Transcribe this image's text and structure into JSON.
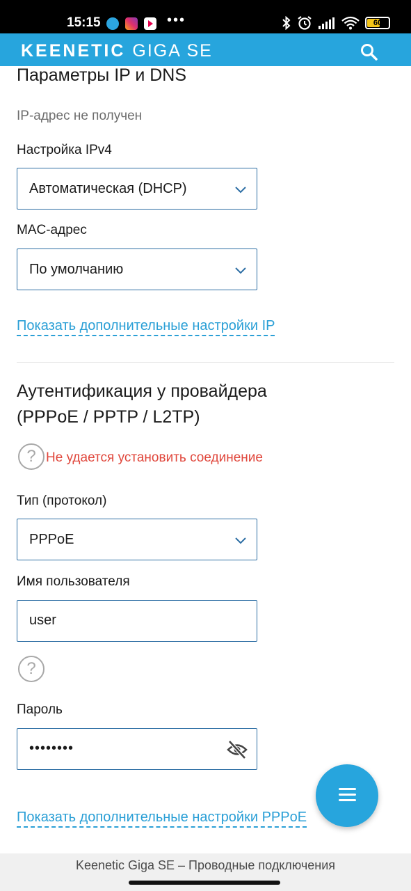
{
  "status_bar": {
    "time": "15:15",
    "battery": "60",
    "apps": [
      "telegram-icon",
      "instagram-icon",
      "youtube-icon"
    ],
    "icons": [
      "bluetooth-icon",
      "alarm-icon",
      "signal-icon",
      "wifi-icon",
      "battery-icon"
    ]
  },
  "header": {
    "brand_bold": "KEENETIC",
    "brand_light": "GIGA SE",
    "search_icon": "search-icon",
    "color": "#27a5dd"
  },
  "ip_section": {
    "title": "Параметры IP и DNS",
    "status": "IP-адрес не получен",
    "ipv4_label": "Настройка IPv4",
    "ipv4_value": "Автоматическая (DHCP)",
    "mac_label": "MAC-адрес",
    "mac_value": "По умолчанию",
    "more_link": "Показать дополнительные настройки IP"
  },
  "auth_section": {
    "title_line1": "Аутентификация у провайдера",
    "title_line2": "(PPPoE / PPTP / L2TP)",
    "help_glyph": "?",
    "error": "Не удается установить соединение",
    "type_label": "Тип (протокол)",
    "type_value": "PPPoE",
    "user_label": "Имя пользователя",
    "user_value": "user",
    "password_label": "Пароль",
    "password_value": "••••••••",
    "more_link": "Показать дополнительные настройки PPPoE",
    "error_color": "#e0473c"
  },
  "footer": {
    "text": "Keenetic Giga SE – Проводные подключения"
  }
}
